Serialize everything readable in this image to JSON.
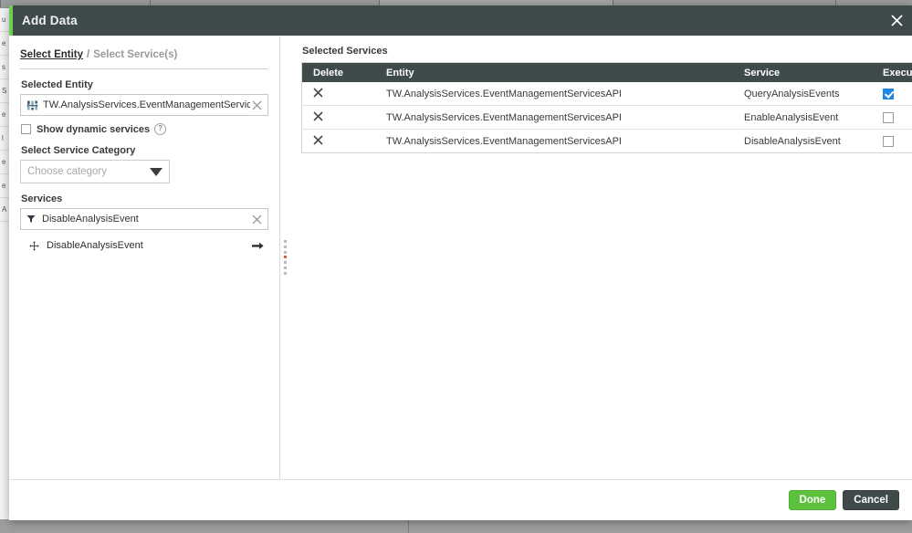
{
  "window": {
    "title": "Add Data",
    "close_icon": "close-icon"
  },
  "breadcrumb": {
    "active": "Select Entity",
    "separator": "/",
    "inactive": "Select Service(s)"
  },
  "left_panel": {
    "selected_entity_label": "Selected Entity",
    "entity_chip": {
      "icon": "thing-entity-icon",
      "text": "TW.AnalysisServices.EventManagementServicesAPI",
      "clear_icon": "clear-icon"
    },
    "show_dynamic_services": {
      "label": "Show dynamic services",
      "checked": false,
      "help_icon": "help-icon",
      "help_glyph": "?"
    },
    "service_category_label": "Select Service Category",
    "category_select": {
      "placeholder": "Choose category",
      "value": "",
      "caret_icon": "chevron-down-icon"
    },
    "services_label": "Services",
    "services_filter": {
      "icon": "filter-icon",
      "value": "DisableAnalysisEvent",
      "clear_icon": "clear-icon"
    },
    "service_list": [
      {
        "drag_icon": "drag-move-icon",
        "name": "DisableAnalysisEvent",
        "add_icon": "arrow-right-icon"
      }
    ]
  },
  "right_panel": {
    "title": "Selected Services",
    "table": {
      "columns": [
        "Delete",
        "Entity",
        "Service",
        "Execute on Load"
      ],
      "rows": [
        {
          "delete_icon": "delete-x-icon",
          "entity": "TW.AnalysisServices.EventManagementServicesAPI",
          "service": "QueryAnalysisEvents",
          "execute_on_load": true
        },
        {
          "delete_icon": "delete-x-icon",
          "entity": "TW.AnalysisServices.EventManagementServicesAPI",
          "service": "EnableAnalysisEvent",
          "execute_on_load": false
        },
        {
          "delete_icon": "delete-x-icon",
          "entity": "TW.AnalysisServices.EventManagementServicesAPI",
          "service": "DisableAnalysisEvent",
          "execute_on_load": false
        }
      ]
    }
  },
  "footer": {
    "done_label": "Done",
    "cancel_label": "Cancel"
  },
  "colors": {
    "header_bar": "#3f4a4a",
    "accent_green": "#6fce4f",
    "done_button": "#5cc13d",
    "checkbox_checked": "#1e87e5",
    "splitter_accent": "#d2652f"
  },
  "background": {
    "rail_rows": [
      "u",
      "e",
      "s",
      "S",
      "e",
      "l",
      "e",
      "e",
      "A"
    ]
  }
}
